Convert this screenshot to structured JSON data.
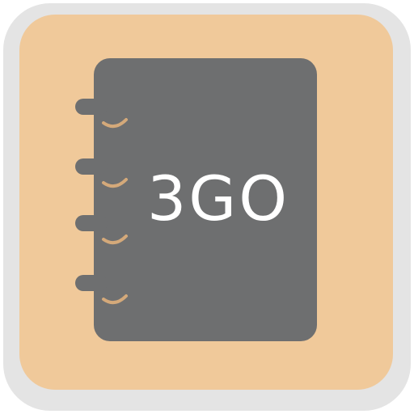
{
  "app_icon": {
    "label": "3GO",
    "colors": {
      "frame": "#e4e4e4",
      "tile": "#f0c99a",
      "notebook": "#6e6f70",
      "text": "#ffffff",
      "ring_arc": "#d4a97a"
    },
    "icons": [
      "spiral-notebook-icon"
    ]
  }
}
